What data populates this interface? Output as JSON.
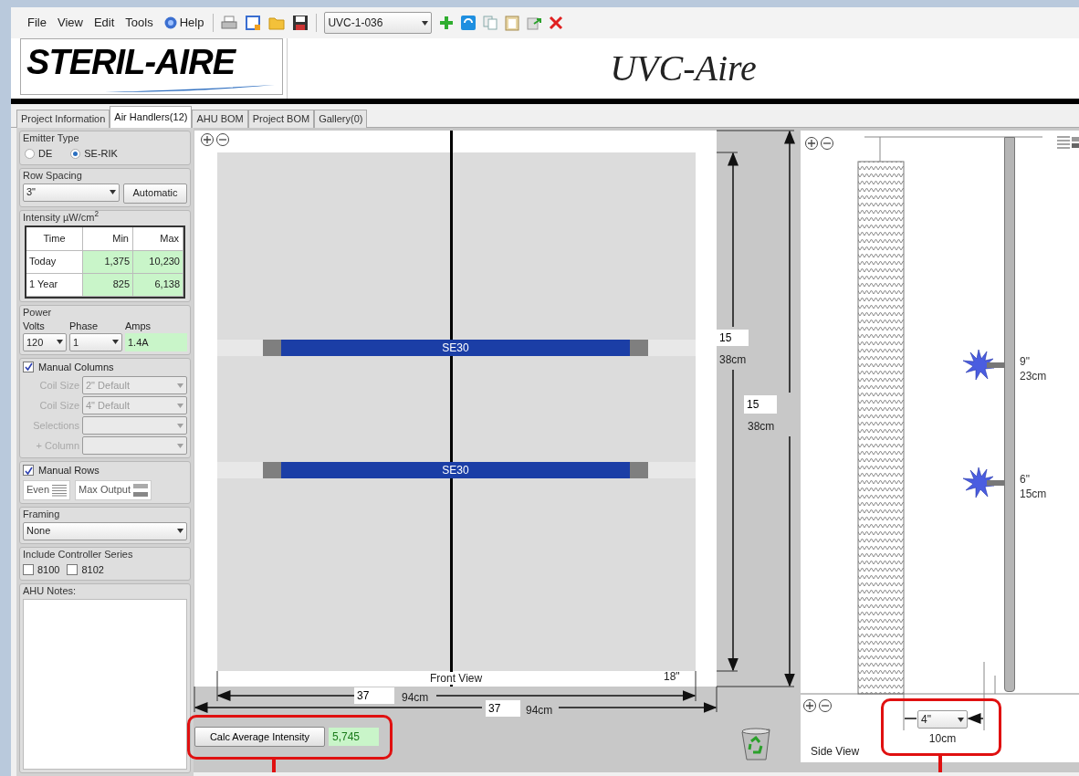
{
  "menu": [
    {
      "label": "File",
      "kind": "plain"
    },
    {
      "label": "View",
      "kind": "plain"
    },
    {
      "label": "Edit",
      "kind": "plain"
    },
    {
      "label": "Tools",
      "kind": "plain"
    },
    {
      "label": "Help",
      "kind": "help"
    }
  ],
  "toolbar": {
    "project_select": "UVC-1-036"
  },
  "logo": "STERIL-AIRE",
  "app_title": "UVC-Aire",
  "tabs": [
    {
      "label": "Project Information",
      "selected": false
    },
    {
      "label": "Air Handlers(12)",
      "selected": true
    },
    {
      "label": "AHU BOM",
      "selected": false
    },
    {
      "label": "Project BOM",
      "selected": false
    },
    {
      "label": "Gallery(0)",
      "selected": false
    }
  ],
  "emitter_type": {
    "label": "Emitter Type",
    "options": [
      {
        "label": "DE",
        "selected": false
      },
      {
        "label": "SE-RIK",
        "selected": true
      }
    ]
  },
  "row_spacing": {
    "label": "Row Spacing",
    "value": "3\"",
    "button": "Automatic"
  },
  "intensity": {
    "label": "Intensity µW/cm$^{2}$",
    "columns": [
      "Time",
      "Min",
      "Max"
    ],
    "rows": [
      [
        "Today",
        "1,375",
        "10,230"
      ],
      [
        "1 Year",
        "825",
        "6,138"
      ]
    ]
  },
  "power": {
    "label": "Power",
    "volts_label": "Volts",
    "phase_label": "Phase",
    "amps_label": "Amps",
    "volts": "120",
    "phase": "1",
    "amps": "1.4A"
  },
  "manual_columns": {
    "label": "Manual Columns",
    "checked": true,
    "fields": [
      {
        "label": "Coil Size",
        "value": "2\" Default",
        "disabled": true
      },
      {
        "label": "Coil Size",
        "value": "4\" Default",
        "disabled": true
      },
      {
        "label": "Selections",
        "disabled": true
      },
      {
        "label": "+ Column",
        "disabled": true
      }
    ]
  },
  "manual_rows": {
    "label": "Manual Rows",
    "checked": true,
    "buttons": [
      "Even",
      "Max Output"
    ]
  },
  "framing": {
    "label": "Framing",
    "value": "None"
  },
  "controller_series": {
    "label": "Include Controller Series",
    "options": [
      {
        "label": "8100",
        "checked": false
      },
      {
        "label": "8102",
        "checked": false
      }
    ]
  },
  "ahu_notes": {
    "label": "AHU Notes:"
  },
  "front_view": {
    "caption": "Front View",
    "corner_label": "18\"",
    "emitters": [
      {
        "label": "SE30"
      },
      {
        "label": "SE30"
      }
    ],
    "inner_width": {
      "value": "37",
      "metric": "94cm"
    },
    "outer_width": {
      "value": "37",
      "metric": "94cm"
    },
    "inner_height": {
      "value": "15",
      "metric": "38cm"
    },
    "outer_height": {
      "value": "15",
      "metric": "38cm"
    }
  },
  "calc_button": "Calc Average Intensity",
  "average_intensity": "5,745",
  "side_view": {
    "caption": "Side View",
    "emitters": [
      {
        "inches": "9\"",
        "metric": "23cm"
      },
      {
        "inches": "6\"",
        "metric": "15cm"
      }
    ],
    "spacing": {
      "value": "4\"",
      "metric": "10cm"
    }
  }
}
